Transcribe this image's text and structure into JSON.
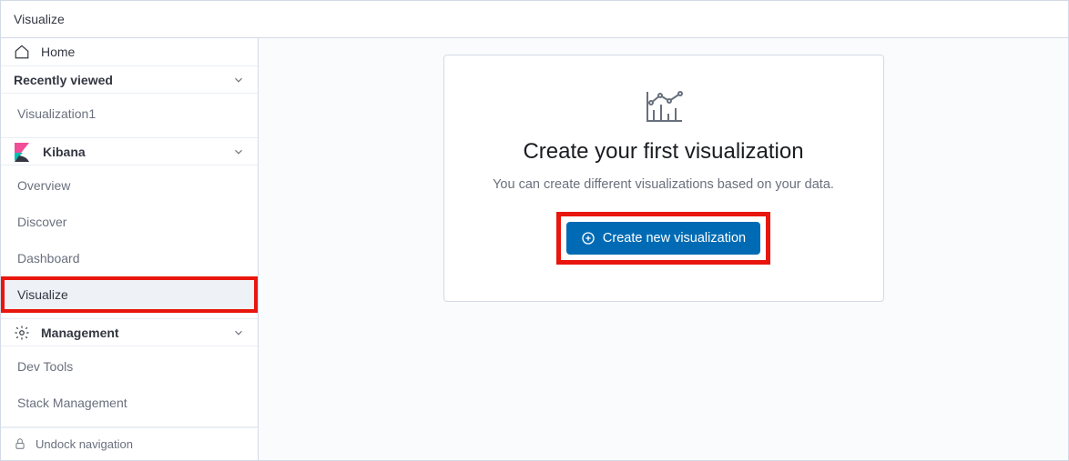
{
  "breadcrumb": {
    "current": "Visualize"
  },
  "sidebar": {
    "home_label": "Home",
    "recently_viewed": {
      "title": "Recently viewed",
      "items": [
        "Visualization1"
      ]
    },
    "kibana": {
      "title": "Kibana",
      "items": [
        "Overview",
        "Discover",
        "Dashboard",
        "Visualize"
      ],
      "active_index": 3
    },
    "management": {
      "title": "Management",
      "items": [
        "Dev Tools",
        "Stack Management"
      ]
    },
    "undock_label": "Undock navigation"
  },
  "main": {
    "title": "Create your first visualization",
    "subtitle": "You can create different visualizations based on your data.",
    "button_label": "Create new visualization"
  }
}
